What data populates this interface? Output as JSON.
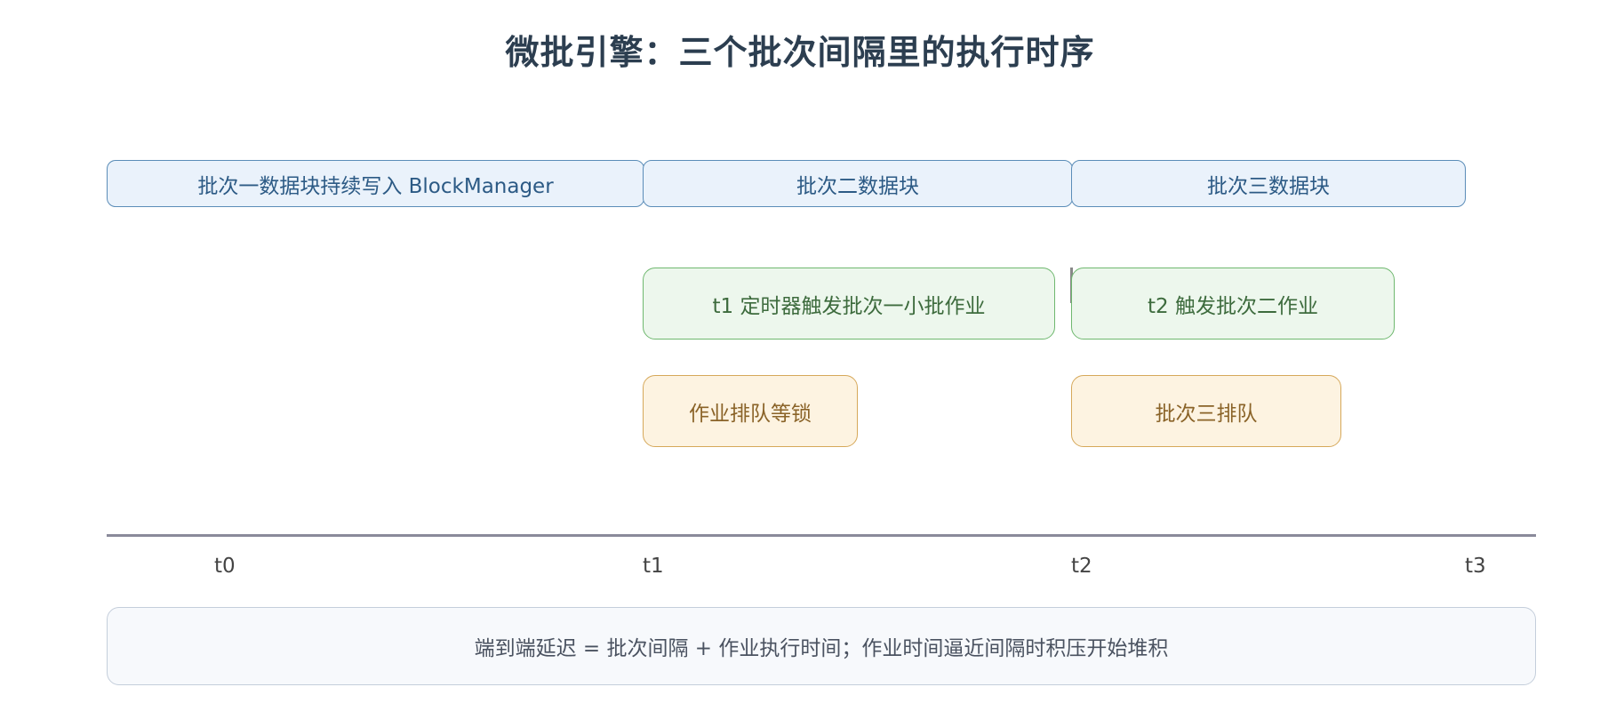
{
  "title": "微批引擎：三个批次间隔里的执行时序",
  "data_blocks": [
    "批次一数据块持续写入 BlockManager",
    "批次二数据块",
    "批次三数据块"
  ],
  "job_blocks": [
    "t1 定时器触发批次一小批作业",
    "t2 触发批次二作业"
  ],
  "queue_blocks": [
    "作业排队等锁",
    "批次三排队"
  ],
  "timeline_ticks": [
    "t0",
    "t1",
    "t2",
    "t3"
  ],
  "footer_note": "端到端延迟 = 批次间隔 + 作业执行时间；作业时间逼近间隔时积压开始堆积",
  "colors": {
    "title": "#2c3e50",
    "data_fill": "#eaf2fb",
    "data_border": "#5b8db8",
    "job_fill": "#edf7ed",
    "job_border": "#6fb86f",
    "queue_fill": "#fdf3e1",
    "queue_border": "#d6a85a",
    "axis": "#8a8a9a"
  }
}
